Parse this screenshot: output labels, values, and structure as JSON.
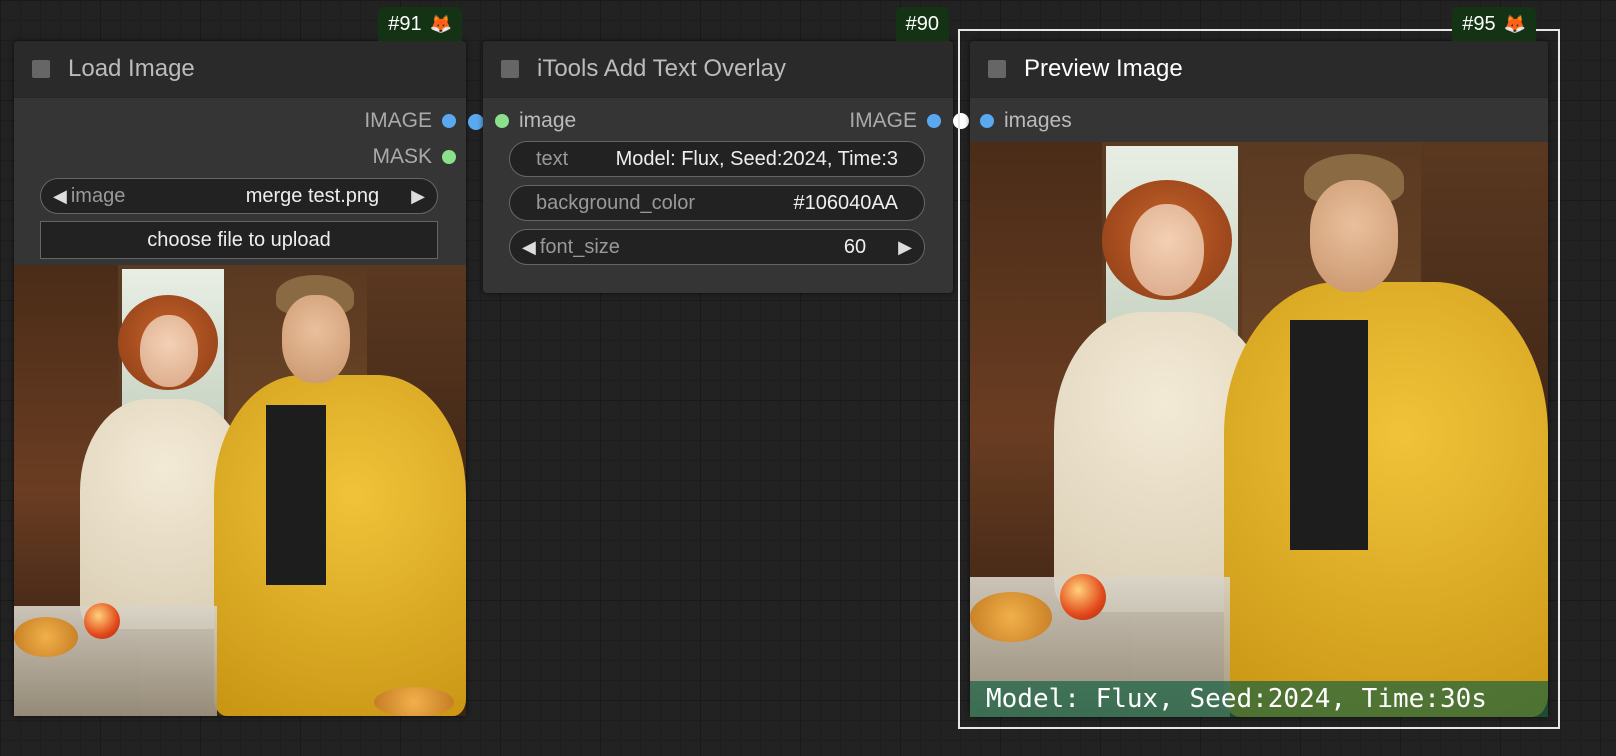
{
  "nodes": {
    "load_image": {
      "id_badge": "#91",
      "title": "Load Image",
      "outputs": {
        "image": "IMAGE",
        "mask": "MASK"
      },
      "combo": {
        "label": "image",
        "value": "merge test.png"
      },
      "upload_label": "choose file to upload"
    },
    "text_overlay": {
      "id_badge": "#90",
      "title": "iTools Add Text Overlay",
      "input_label": "image",
      "output_label": "IMAGE",
      "widgets": {
        "text": {
          "label": "text",
          "value": "Model: Flux, Seed:2024, Time:3"
        },
        "background_color": {
          "label": "background_color",
          "value": "#106040AA"
        },
        "font_size": {
          "label": "font_size",
          "value": "60"
        }
      }
    },
    "preview_image": {
      "id_badge": "#95",
      "title": "Preview Image",
      "input_label": "images",
      "overlay_text": "Model: Flux, Seed:2024, Time:30s"
    }
  },
  "colors": {
    "canvas": "#222222",
    "node_body": "#353535",
    "node_header": "#2a2a2a",
    "badge_bg": "#143314",
    "image_slot": "#5aa9f0",
    "mask_slot": "#8be08b",
    "overlay_bg": "#106040AA"
  },
  "icons": {
    "badge_icon": "fox-icon",
    "collapse": "collapse-toggle-icon",
    "arrow_left": "arrow-left-icon",
    "arrow_right": "arrow-right-icon"
  }
}
